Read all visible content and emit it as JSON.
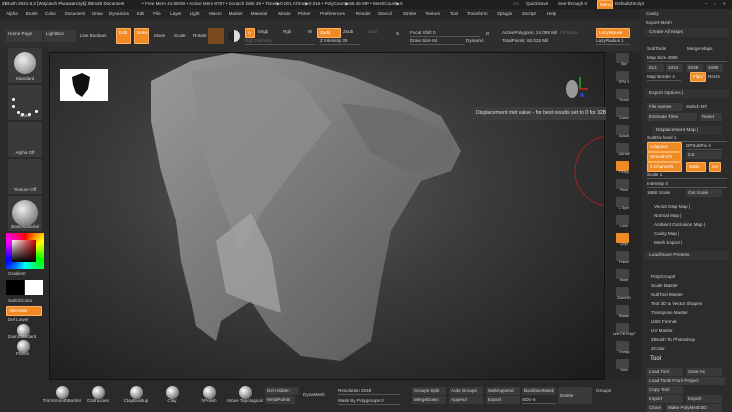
{
  "title_bar": {
    "title": "ZBrush 2021.6.2 [Wojciech Piwowarczyk]   ZBrush Document",
    "stats": "• Free Mem 44.99GB • Active Mem 8787 • Scratch Disk 49 • Timer▶0.001 ATime▶0.016 • PolyCount▶56.46 MP • MeshCount▶5",
    "ac": "AC",
    "quicksave": "QuickSave",
    "see_through": "See-through 0",
    "menus": "Menus",
    "default_zscript": "DefaultZScript"
  },
  "menu": [
    "Alpha",
    "Brush",
    "Color",
    "Document",
    "Draw",
    "Dynamics",
    "Edit",
    "File",
    "Layer",
    "Light",
    "Macro",
    "Marker",
    "Material",
    "Movie",
    "Picker",
    "Preferences",
    "Render",
    "Stencil",
    "Stroke",
    "Texture",
    "Tool",
    "Transform",
    "Zplugin",
    "Zscript",
    "Help"
  ],
  "shelf": {
    "home_page": "Home Page",
    "lightbox": "LightBox",
    "live_boolean": "Live Boolean",
    "edit": "Edit",
    "draw": "Draw",
    "move": "Move",
    "scale": "Scale",
    "rotate": "Rotate",
    "a": "A",
    "mrgb": "Mrgb",
    "rgb": "Rgb",
    "m": "M",
    "zadd": "Zadd",
    "zsub": "Zsub",
    "zcut": "Zcut",
    "rgb_intensity": "Rgb Intensity",
    "z_intensity": "Z Intensity 25",
    "focal_shift": "Focal Shift 0",
    "draw_size": "Draw Size 64",
    "dynamic": "Dynamic",
    "active_polygons": "ActivePolygons: 24.095 Mil",
    "total_points": "TotalPoints: 60.033 Mil",
    "fill_mode": "Fill Mode",
    "lazymouse": "LazyMouse",
    "lazyradius": "LazyRadius 1",
    "s_label": "S",
    "d_label": "D"
  },
  "left": {
    "brush": "Standard",
    "stroke": "Dots",
    "alpha": "Alpha Off",
    "texture": "Texture Off",
    "material": "BasicMaterial",
    "gradient": "Gradient",
    "switch_color": "SwitchColor",
    "alternate": "Alternate",
    "del_lower": "Del Lower",
    "dam_standard": "DamStandard",
    "planar": "Planar"
  },
  "tooltip": "Displacement mid value - for best results set to 0 for 32Bit",
  "right_strip": [
    "Bpr",
    "SPix 3",
    "Scroll",
    "Zoom",
    "Actual",
    "AAHalf",
    "Persp",
    "Floor",
    "L.Sym",
    "Lock",
    "Qxyz",
    "Frame",
    "Move",
    "Zoom3D",
    "Rotate",
    "Line Fill PolyF",
    "Transp",
    "Solo"
  ],
  "right_panel": {
    "cavity": "Cavity",
    "export_mesh": "Export Mesh",
    "create_all_maps": "Create All Maps",
    "subtools": "SubTools",
    "merge_maps": "Merge Maps",
    "map_size": "Map Size 4096",
    "s512": "512",
    "s1024": "1024",
    "s2048": "2048",
    "s4096": "4096",
    "map_border": "Map Border 4",
    "flipv": "FlipV",
    "reuv": "ReUV",
    "export_options": "Export Options |",
    "file_names": "File names",
    "switch_mt": "Switch MT",
    "estimate_time": "Estimate Time",
    "reset": "Reset",
    "displacement_map": "Displacement Map |",
    "subdiv_level": "SubDiv level 1",
    "adaptive": "Adaptive",
    "dpsubpix": "DPSubPix 4",
    "smoothuv": "SmoothUV",
    "mid_value": "0.5",
    "channels": "3 Channels",
    "bit32": "32Bit",
    "exr": "exr",
    "scale": "Scale 1",
    "intensity": "Intensity 0",
    "bit16_scale": "16Bit Scale",
    "get_scale": "Get Scale",
    "vector_disp_map": "Vector Disp Map |",
    "normal_map": "Normal Map |",
    "ao_map": "Ambient Occlusion Map |",
    "cavity_map": "Cavity Map |",
    "mesh_export": "Mesh Export |",
    "load_save_presets": "Load/Save Presets",
    "plugins": [
      "PolyGroupIt",
      "Scale Master",
      "SubTool Master",
      "Text 3D & Vector Shapes",
      "Transpose Master",
      "USD Format",
      "UV Master",
      "ZBrush To Photoshop",
      "ZColor"
    ],
    "tool": "Tool",
    "load_tool": "Load Tool",
    "save_as": "Save As",
    "load_tools_from_project": "Load Tools From Project",
    "copy_tool": "Copy Tool",
    "import": "Import",
    "export": "Export",
    "clone": "Clone",
    "make_polymesh": "Make PolyMesh3D"
  },
  "bottom": {
    "brushes": [
      "TrimSmoothBorder",
      "ClothLines",
      "ClayBuildup",
      "Clay",
      "hPolish",
      "Move Topological"
    ],
    "del_hidden": "Del Hidden",
    "weld_points": "WeldPoints",
    "dynamesh": "DynaMesh",
    "resolution": "Resolution 2048",
    "mask_by_polygroups": "Mask By Polygroups 0",
    "groups_split": "Groups Split",
    "auto_groups": "Auto Groups",
    "multi_append": "MultiAppend",
    "backface_mask": "BackfaceMask",
    "merge_down": "MergeDown",
    "append": "Append",
    "export": "Export",
    "sdiv": "SDiv 6",
    "delete": "Delete",
    "groups": "Groups"
  },
  "colors": {
    "accent": "#f08a24",
    "panel": "#2c2c2c",
    "canvas": "#3a3a3a"
  }
}
